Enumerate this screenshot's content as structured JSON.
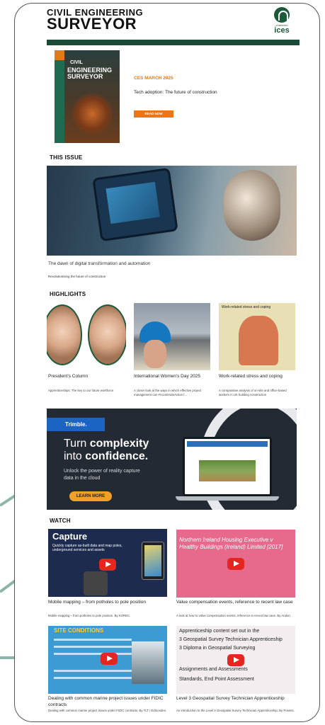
{
  "masthead": {
    "line1": "CIVIL ENGINEERING",
    "line2": "SURVEYOR",
    "logo_sub": "chartered",
    "logo_name": "ices"
  },
  "issue": {
    "cover_line1": "CIVIL",
    "cover_line2": "ENGINEERING SURVEYOR",
    "tag": "CES MARCH 2025",
    "description": "Tech adoption: The future of construction",
    "read_button": "READ NOW"
  },
  "this_issue": {
    "heading": "THIS ISSUE",
    "caption": "The dawn of digital transformation and automation",
    "subcaption": "Revolutionising the future of construction"
  },
  "highlights": {
    "heading": "HIGHLIGHTS",
    "cards": [
      {
        "title": "President's Column",
        "desc": "Apprenticeships: The key to our future workforce"
      },
      {
        "title": "International Women's Day 2025",
        "desc": "A closer look at the ways in which effective project management can #AccelerateAction f..."
      },
      {
        "title": "Work-related stress and coping",
        "desc": "A comparative analysis of on-site and office-based workers in UK building construction",
        "art_text": "Work-related stress and coping"
      }
    ]
  },
  "ad": {
    "brand": "Trimble.",
    "line1_pre": "Turn ",
    "line1_bold": "complexity",
    "line2_pre": "into ",
    "line2_bold": "confidence.",
    "sub": "Unlock the power of reality capture data in the cloud",
    "button": "LEARN MORE"
  },
  "watch": {
    "heading": "WATCH",
    "videos": [
      {
        "thumb_title": "Capture",
        "thumb_sub": "Quickly capture as-built data and map poles, underground services and assets",
        "title": "Mobile mapping – from potholes to pole position",
        "desc": "Mobile mapping – from potholes to pole position. By KOREC."
      },
      {
        "thumb_title": "Northern Ireland Housing Executive v Healthy Buildings (Ireland) Limited [2017]",
        "title": "Value compensation events, reference to recent law case",
        "desc": "A look at how to value compensation events, reference to recent law case. By Andon."
      },
      {
        "thumb_title": "SITE CONDITIONS",
        "title": "Dealing with common marine project issues under FIDIC contracts",
        "desc": "Dealing with common marine project issues under FIDIC contracts. By TLT / Edmondes."
      },
      {
        "thumb_lines": [
          "Apprenticeship content set out in the",
          "3 Geospatial Survey Technician Apprenticeship",
          "3 Diploma in Geospatial Surveying",
          "Assignments and Assessments",
          "Standards, End Point Assessment"
        ],
        "title": "Level 3 Geospatial Survey Technician Apprenticeship",
        "desc": "An introduction to the Level 3 Geospatial Survey Technician Apprenticeship. By Powers."
      }
    ]
  },
  "colors": {
    "brand_green": "#1b4a38",
    "accent_orange": "#e8761b",
    "trimble_blue": "#1b64c4",
    "play_red": "#e52620",
    "pointer_arrow": "#8db5ac"
  }
}
